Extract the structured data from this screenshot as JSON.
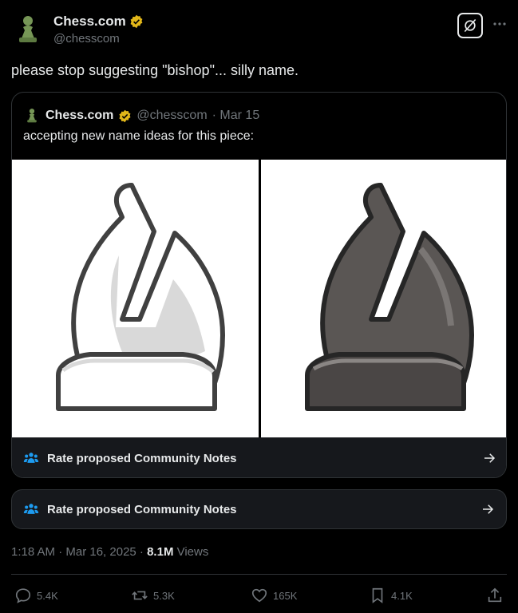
{
  "author": {
    "name": "Chess.com",
    "handle": "@chesscom"
  },
  "tweet": {
    "text": "please stop suggesting \"bishop\"... silly name."
  },
  "quote": {
    "name": "Chess.com",
    "handle": "@chesscom",
    "date": "· Mar 15",
    "text": "accepting new name ideas for this piece:",
    "notes_label": "Rate proposed Community Notes"
  },
  "notes": {
    "label": "Rate proposed Community Notes"
  },
  "meta": {
    "time": "1:18 AM · Mar 16, 2025 · ",
    "views": "8.1M",
    "views_label": " Views"
  },
  "actions": {
    "replies": "5.4K",
    "reposts": "5.3K",
    "likes": "165K",
    "bookmarks": "4.1K"
  },
  "colors": {
    "verified": "#e2b719",
    "notes_icon": "#1d9bf0",
    "pawn": "#769656"
  },
  "icons": [
    "pawn-avatar-icon",
    "verified-badge-icon",
    "grok-icon",
    "more-icon",
    "people-icon",
    "arrow-right-icon",
    "reply-icon",
    "repost-icon",
    "like-icon",
    "bookmark-icon",
    "share-icon"
  ]
}
